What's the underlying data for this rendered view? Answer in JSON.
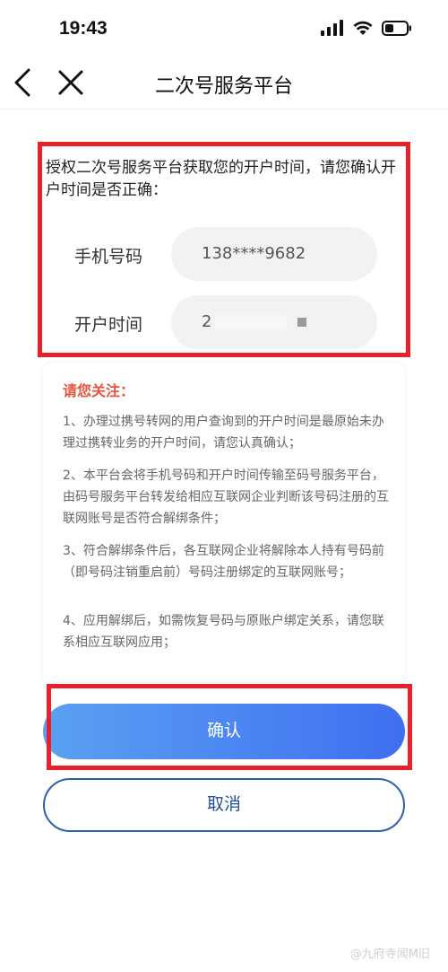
{
  "status_bar": {
    "time": "19:43"
  },
  "nav": {
    "title": "二次号服务平台"
  },
  "auth": {
    "intro": "授权二次号服务平台获取您的开户时间，请您确认开户时间是否正确：",
    "phone_label": "手机号码",
    "phone_value": "138****9682",
    "open_time_label": "开户时间",
    "open_time_value": "2"
  },
  "notice": {
    "title": "请您关注：",
    "items": [
      "1、办理过携号转网的用户查询到的开户时间是最原始未办理过携转业务的开户时间，请您认真确认；",
      "2、本平台会将手机号码和开户时间传输至码号服务平台，由码号服务平台转发给相应互联网企业判断该号码注册的互联网账号是否符合解绑条件；",
      "3、符合解绑条件后，各互联网企业将解除本人持有号码前（即号码注销重启前）号码注册绑定的互联网账号；",
      "4、应用解绑后，如需恢复号码与原账户绑定关系，请您联系相应互联网应用；"
    ]
  },
  "buttons": {
    "confirm": "确认",
    "cancel": "取消"
  },
  "watermark": "@九府寺闻M旧"
}
